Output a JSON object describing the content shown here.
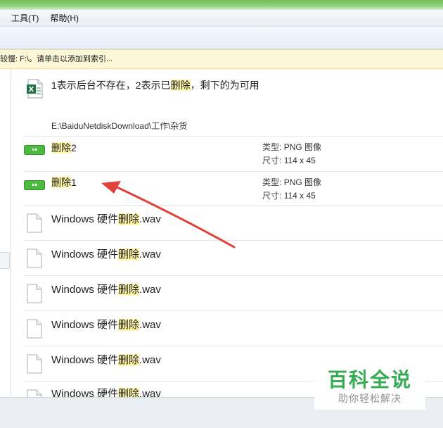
{
  "menu": {
    "items": [
      {
        "label": "工具(T)"
      },
      {
        "label": "帮助(H)"
      }
    ]
  },
  "infobar": {
    "text": "较慢: F:\\。请单击以添加到索引..."
  },
  "results": {
    "doc": {
      "title_prefix": "1表示后台不存在，2表示已",
      "title_highlight": "删除",
      "title_suffix": "，剩下的为可用",
      "path": "E:\\BaiduNetdiskDownload\\工作\\杂货"
    },
    "images": [
      {
        "name_highlight": "删除",
        "name_suffix": "2",
        "type_label": "类型:",
        "type_value": "PNG 图像",
        "size_label": "尺寸:",
        "size_value": "114 x 45"
      },
      {
        "name_highlight": "删除",
        "name_suffix": "1",
        "type_label": "类型:",
        "type_value": "PNG 图像",
        "size_label": "尺寸:",
        "size_value": "114 x 45"
      }
    ],
    "wav_files": [
      {
        "prefix": "Windows 硬件",
        "highlight": "删除",
        "suffix": ".wav"
      },
      {
        "prefix": "Windows 硬件",
        "highlight": "删除",
        "suffix": ".wav"
      },
      {
        "prefix": "Windows 硬件",
        "highlight": "删除",
        "suffix": ".wav"
      },
      {
        "prefix": "Windows 硬件",
        "highlight": "删除",
        "suffix": ".wav"
      },
      {
        "prefix": "Windows 硬件",
        "highlight": "删除",
        "suffix": ".wav"
      },
      {
        "prefix": "Windows 硬件",
        "highlight": "删除",
        "suffix": ".wav"
      }
    ]
  },
  "watermark": {
    "title": "百科全说",
    "subtitle": "助你轻松解决"
  },
  "colors": {
    "highlight": "#fff6a8",
    "arrow": "#e2423a",
    "watermark_green": "#2aa84a",
    "image_icon_green": "#4dbb3f"
  }
}
